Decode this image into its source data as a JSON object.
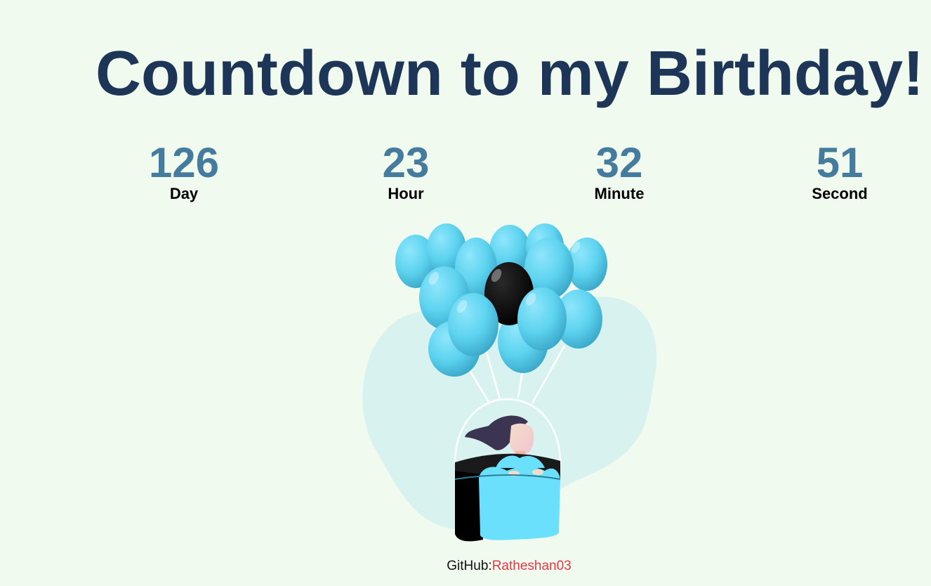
{
  "page": {
    "title": "Countdown to my Birthday!"
  },
  "countdown": {
    "days": {
      "value": "126",
      "label": "Day"
    },
    "hours": {
      "value": "23",
      "label": "Hour"
    },
    "minutes": {
      "value": "32",
      "label": "Minute"
    },
    "seconds": {
      "value": "51",
      "label": "Second"
    }
  },
  "illustration": {
    "icon": "girl-with-balloons-illustration",
    "colors": {
      "blob": "#d8f3ef",
      "balloon": "#5dd3f0",
      "balloon_dark": "#000000",
      "basket": "#6ae0fc",
      "hair": "#3b3552",
      "skin": "#f3d2c9"
    }
  },
  "footer": {
    "prefix": "GitHub:",
    "link_text": "Ratheshan03"
  },
  "theme": {
    "background": "#f1faee",
    "title_color": "#1d3557",
    "number_color": "#457b9d",
    "link_color": "#e63946"
  }
}
